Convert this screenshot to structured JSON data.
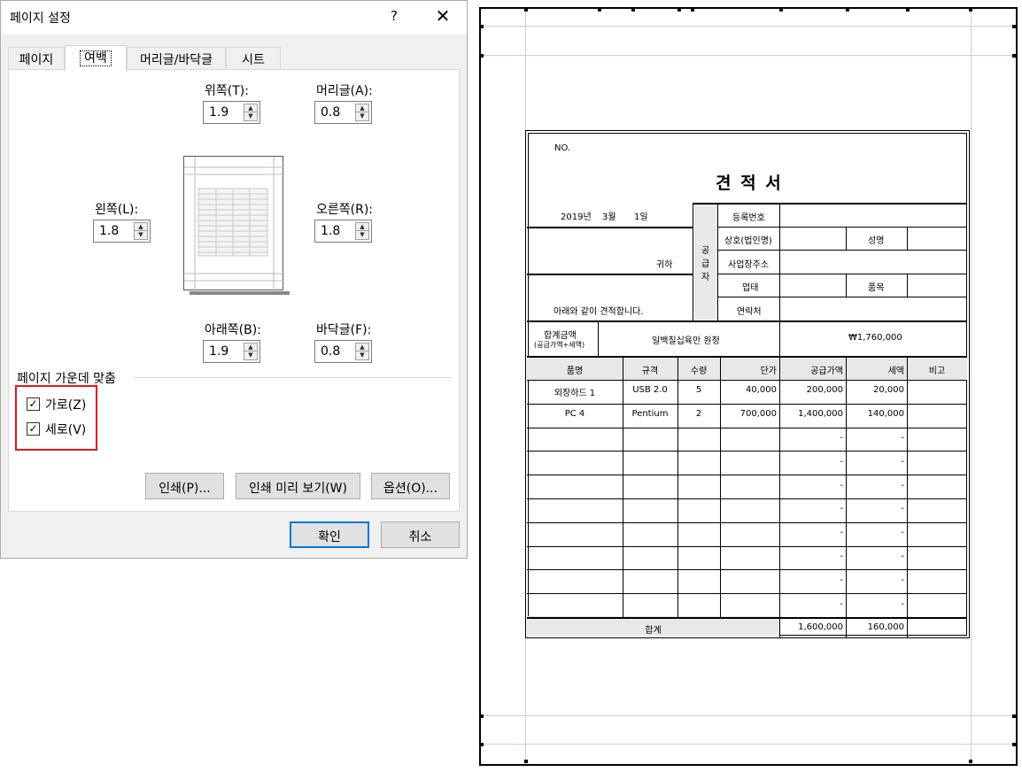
{
  "dialog": {
    "title": "페이지 설정",
    "help": "?",
    "close": "✕",
    "tabs": [
      "페이지",
      "여백",
      "머리글/바닥글",
      "시트"
    ],
    "margins": {
      "top_label": "위쪽(T):",
      "top_value": "1.9",
      "header_label": "머리글(A):",
      "header_value": "0.8",
      "left_label": "왼쪽(L):",
      "left_value": "1.8",
      "right_label": "오른쪽(R):",
      "right_value": "1.8",
      "bottom_label": "아래쪽(B):",
      "bottom_value": "1.9",
      "footer_label": "바닥글(F):",
      "footer_value": "0.8"
    },
    "center": {
      "title": "페이지 가운데 맞춤",
      "horizontal_label": "가로(Z)",
      "horizontal_checked": true,
      "vertical_label": "세로(V)",
      "vertical_checked": true
    },
    "buttons": {
      "print": "인쇄(P)...",
      "print_preview": "인쇄 미리 보기(W)",
      "options": "옵션(O)...",
      "ok": "확인",
      "cancel": "취소"
    },
    "colors": {
      "highlight": "#e0161b",
      "accent": "#0078d7"
    }
  },
  "quote": {
    "no": "NO.",
    "title": "견 적 서",
    "date": {
      "year": "2019년",
      "month": "3월",
      "day": "1일"
    },
    "recipient_suffix": "귀하",
    "greeting": "아래와 같이 견적합니다.",
    "supplier_label": [
      "공",
      "급",
      "자"
    ],
    "supplier_fields": {
      "reg_no": "등록번호",
      "company": "상호(법인명)",
      "name": "성명",
      "address": "사업장주소",
      "business_type": "업태",
      "item": "품목",
      "contact": "연락처"
    },
    "total_label": "합계금액",
    "total_sub": "(공급가액+세액)",
    "total_words": "일백칠십육만 원정",
    "total_amount": "₩1,760,000",
    "columns": [
      "품명",
      "규격",
      "수량",
      "단가",
      "공급가액",
      "세액",
      "비고"
    ],
    "rows": [
      [
        "외장하드 1",
        "USB 2.0",
        "5",
        "40,000",
        "200,000",
        "20,000",
        ""
      ],
      [
        "PC 4",
        "Pentium",
        "2",
        "700,000",
        "1,400,000",
        "140,000",
        ""
      ],
      [
        "",
        "",
        "",
        "",
        "-",
        "-",
        ""
      ],
      [
        "",
        "",
        "",
        "",
        "-",
        "-",
        ""
      ],
      [
        "",
        "",
        "",
        "",
        "-",
        "-",
        ""
      ],
      [
        "",
        "",
        "",
        "",
        "-",
        "-",
        ""
      ],
      [
        "",
        "",
        "",
        "",
        "-",
        "-",
        ""
      ],
      [
        "",
        "",
        "",
        "",
        "-",
        "-",
        ""
      ],
      [
        "",
        "",
        "",
        "",
        "-",
        "-",
        ""
      ],
      [
        "",
        "",
        "",
        "",
        "-",
        "-",
        ""
      ]
    ],
    "sum_label": "합계",
    "sum_supply": "1,600,000",
    "sum_tax": "160,000"
  }
}
